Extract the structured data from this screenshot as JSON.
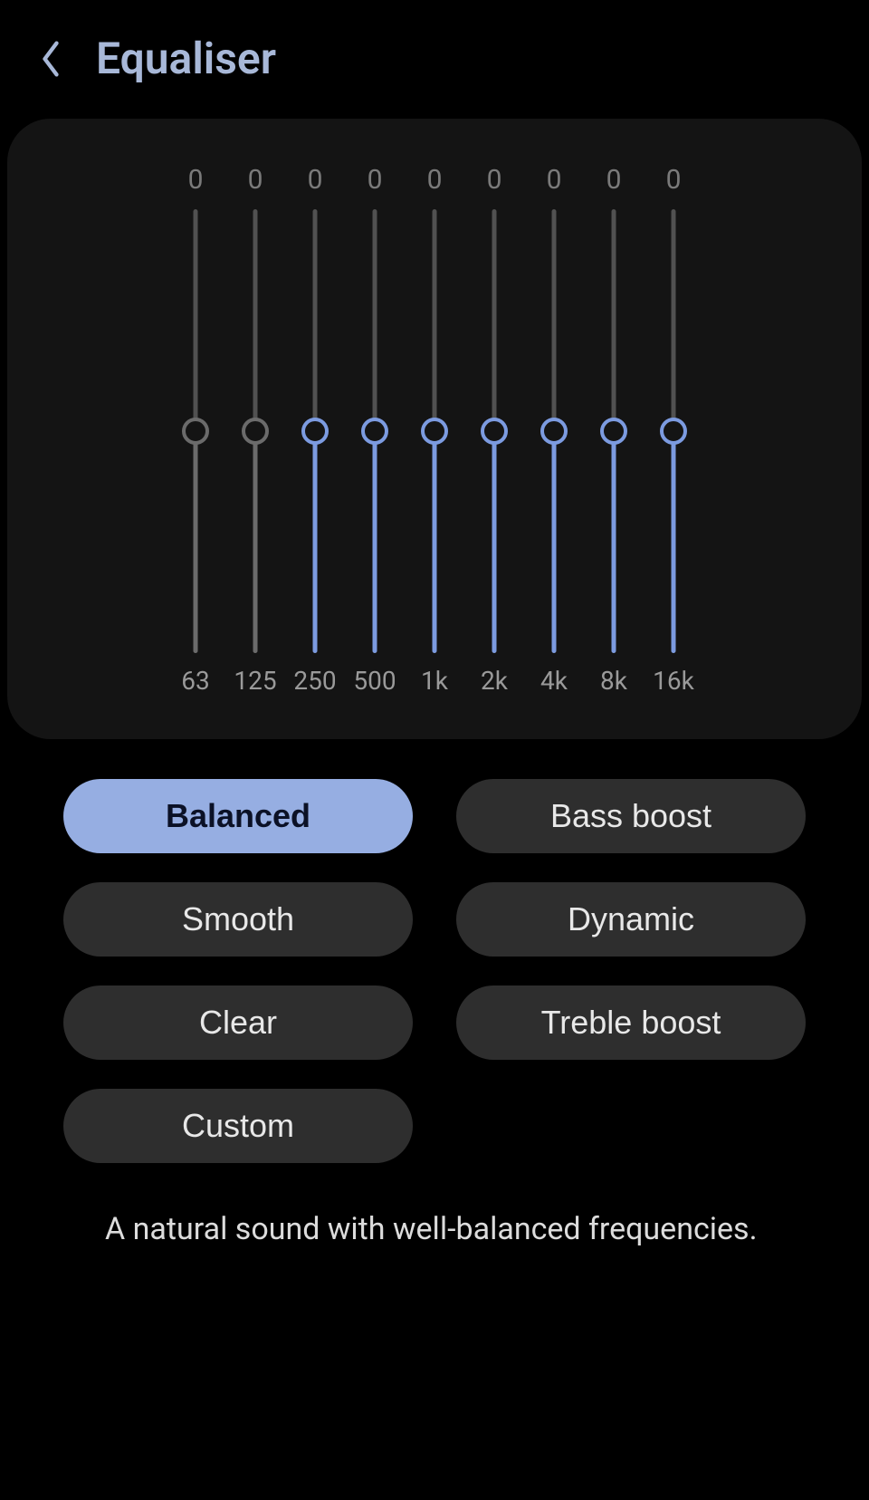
{
  "header": {
    "title": "Equaliser"
  },
  "equalizer": {
    "bands": [
      {
        "freq": "63",
        "value": "0",
        "pos": 50,
        "active": false
      },
      {
        "freq": "125",
        "value": "0",
        "pos": 50,
        "active": false
      },
      {
        "freq": "250",
        "value": "0",
        "pos": 50,
        "active": true
      },
      {
        "freq": "500",
        "value": "0",
        "pos": 50,
        "active": true
      },
      {
        "freq": "1k",
        "value": "0",
        "pos": 50,
        "active": true
      },
      {
        "freq": "2k",
        "value": "0",
        "pos": 50,
        "active": true
      },
      {
        "freq": "4k",
        "value": "0",
        "pos": 50,
        "active": true
      },
      {
        "freq": "8k",
        "value": "0",
        "pos": 50,
        "active": true
      },
      {
        "freq": "16k",
        "value": "0",
        "pos": 50,
        "active": true
      }
    ],
    "colors": {
      "active": "#7c9be0",
      "inactive": "#6b6b6b"
    }
  },
  "presets": [
    {
      "label": "Balanced",
      "active": true
    },
    {
      "label": "Bass boost",
      "active": false
    },
    {
      "label": "Smooth",
      "active": false
    },
    {
      "label": "Dynamic",
      "active": false
    },
    {
      "label": "Clear",
      "active": false
    },
    {
      "label": "Treble boost",
      "active": false
    },
    {
      "label": "Custom",
      "active": false
    }
  ],
  "description": "A natural sound with well-balanced frequencies."
}
